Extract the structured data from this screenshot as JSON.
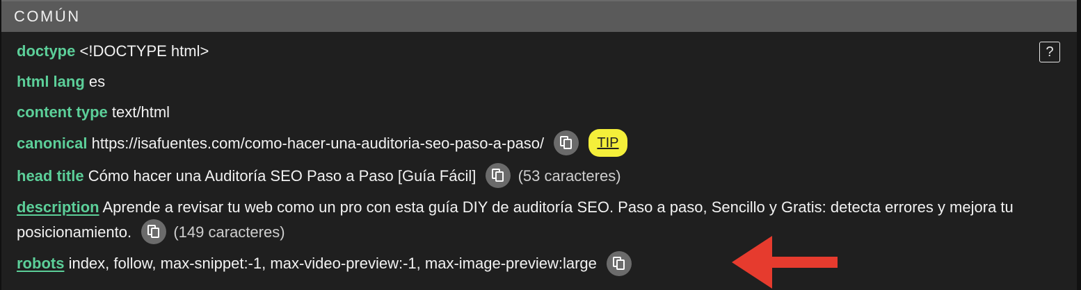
{
  "section": {
    "title": "COMÚN"
  },
  "help": {
    "label": "?"
  },
  "rows": {
    "doctype": {
      "key": "doctype",
      "value": "<!DOCTYPE html>"
    },
    "html_lang": {
      "key": "html lang",
      "value": "es"
    },
    "content_type": {
      "key": "content type",
      "value": "text/html"
    },
    "canonical": {
      "key": "canonical",
      "value": "https://isafuentes.com/como-hacer-una-auditoria-seo-paso-a-paso/",
      "tip": "TIP"
    },
    "head_title": {
      "key": "head title",
      "value": "Cómo hacer una Auditoría SEO Paso a Paso [Guía Fácil]",
      "count": "(53 caracteres)"
    },
    "description": {
      "key": "description",
      "value": "Aprende a revisar tu web como un pro con esta guía DIY de auditoría SEO. Paso a paso, Sencillo y Gratis: detecta errores y mejora tu posicionamiento.",
      "count": "(149 caracteres)"
    },
    "robots": {
      "key": "robots",
      "value": "index, follow, max-snippet:-1, max-video-preview:-1, max-image-preview:large"
    }
  },
  "icons": {
    "copy": "copy-icon",
    "help": "help-icon",
    "annotation": "red-arrow"
  },
  "colors": {
    "key": "#5ccf99",
    "header_bg": "#5a5a5a",
    "tip_bg": "#f4ef3a",
    "arrow": "#e63b2e",
    "copy_bg": "#6b6b6b"
  }
}
